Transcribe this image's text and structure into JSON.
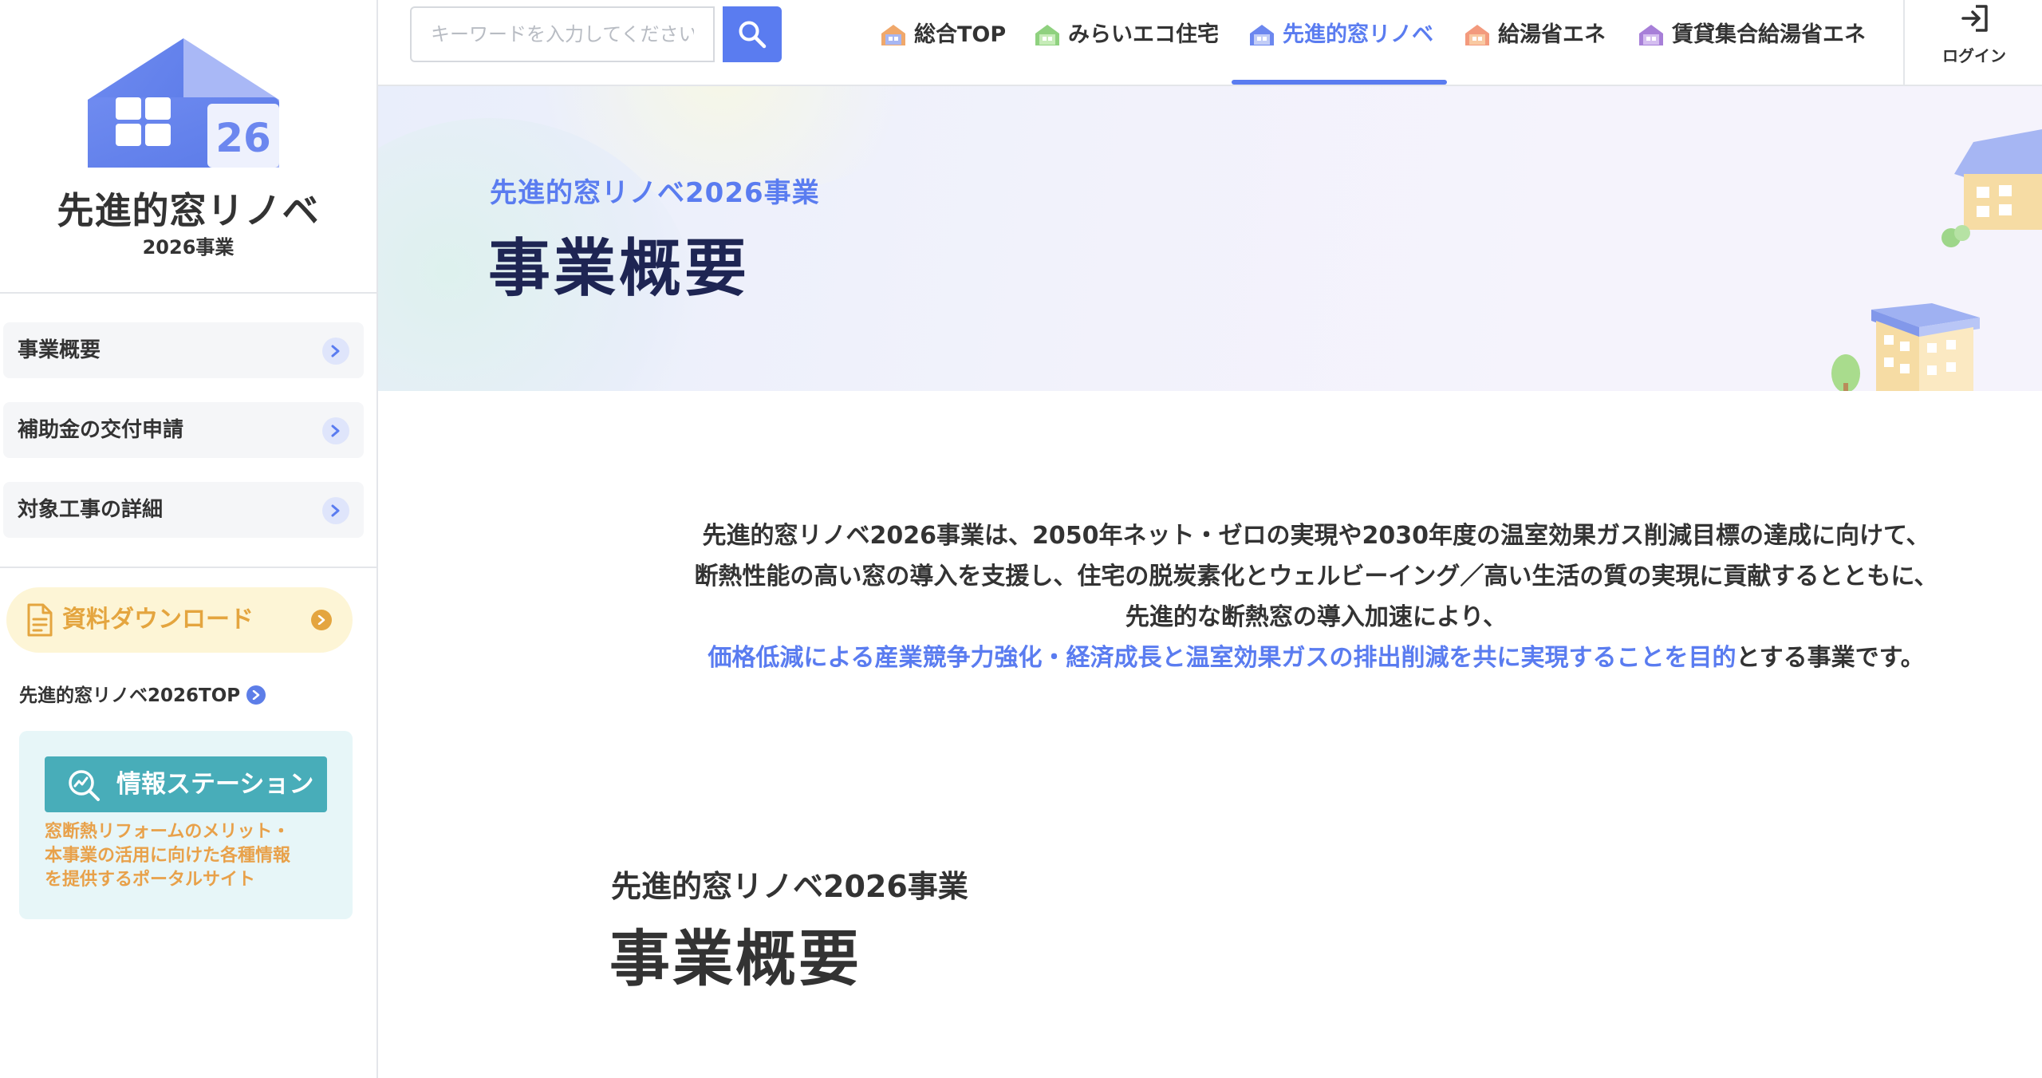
{
  "sidebar": {
    "logo": {
      "badge_number": "26",
      "title": "先進的窓リノベ",
      "subtitle": "2026事業",
      "colors": {
        "house": "#6c87ef",
        "roof": "#8ea3f3"
      }
    },
    "nav_items": [
      {
        "label": "事業概要",
        "icon": "chevron-right-icon"
      },
      {
        "label": "補助金の交付申請",
        "icon": "chevron-right-icon"
      },
      {
        "label": "対象工事の詳細",
        "icon": "chevron-right-icon"
      }
    ],
    "download": {
      "label": "資料ダウンロード",
      "icon": "document-icon"
    },
    "top_link": {
      "label": "先進的窓リノベ2026TOP"
    },
    "info_station": {
      "button_label": "情報ステーション",
      "icon": "search-chart-icon",
      "description": "窓断熱リフォームのメリット・\n本事業の活用に向けた各種情報\nを提供するポータルサイト"
    }
  },
  "header": {
    "search": {
      "placeholder": "キーワードを入力してください",
      "icon": "search-icon"
    },
    "nav": [
      {
        "label": "総合TOP",
        "icon": "house-icon",
        "color": "#f0a86b",
        "active": false
      },
      {
        "label": "みらいエコ住宅",
        "icon": "house-icon",
        "color": "#8fd17f",
        "active": false
      },
      {
        "label": "先進的窓リノベ",
        "icon": "house-icon",
        "color": "#6c87ef",
        "active": true
      },
      {
        "label": "給湯省エネ",
        "icon": "house-icon",
        "color": "#f39a7d",
        "active": false
      },
      {
        "label": "賃貸集合給湯省エネ",
        "icon": "house-icon",
        "color": "#a77fd8",
        "active": false
      }
    ],
    "login": {
      "label": "ログイン",
      "icon": "login-icon"
    }
  },
  "hero": {
    "subtitle": "先進的窓リノベ2026事業",
    "title": "事業概要"
  },
  "intro": {
    "line1": "先進的窓リノベ2026事業は、2050年ネット・ゼロの実現や2030年度の温室効果ガス削減目標の達成に向けて、",
    "line2": "断熱性能の高い窓の導入を支援し、住宅の脱炭素化とウェルビーイング／高い生活の質の実現に貢献するとともに、",
    "line3": "先進的な断熱窓の導入加速により、",
    "line4_highlight": "価格低減による産業競争力強化・経済成長と温室効果ガスの排出削減を共に実現することを目的",
    "line4_rest": "とする事業です。"
  },
  "section": {
    "subtitle": "先進的窓リノベ2026事業",
    "title": "事業概要"
  },
  "colors": {
    "accent": "#5a7cf0",
    "download": "#e4a53f",
    "info_station": "#48adb9"
  }
}
